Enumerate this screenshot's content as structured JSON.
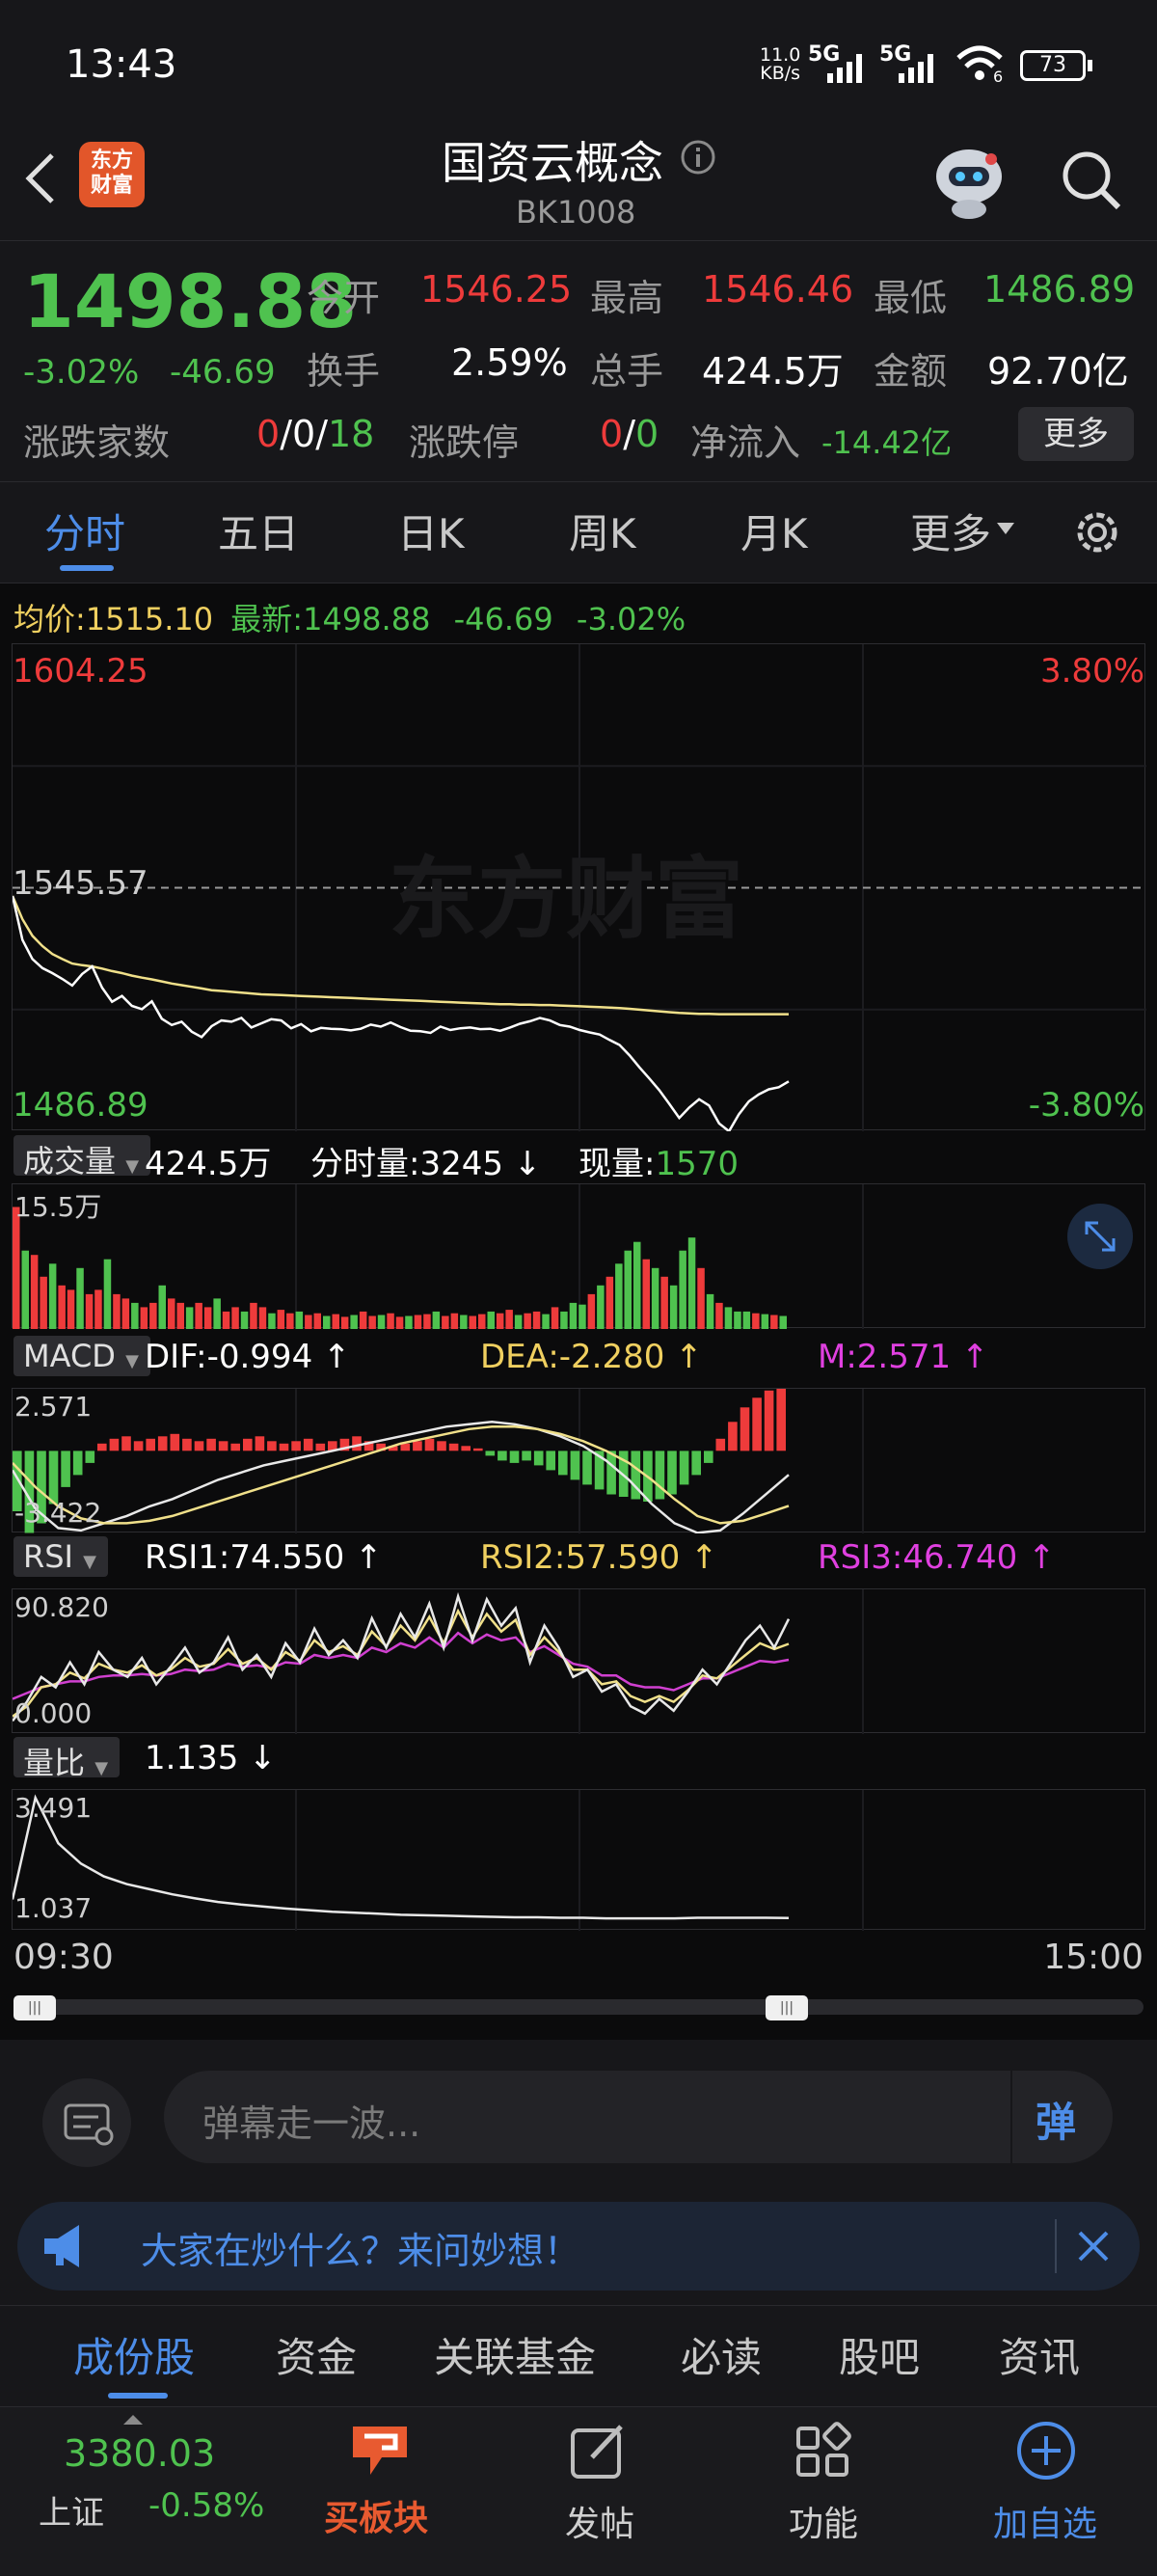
{
  "status_bar": {
    "time": "13:43",
    "net_speed": "11.0",
    "net_unit": "KB/s",
    "sig1": "5G",
    "sig2": "5G",
    "battery": "73",
    "wifi_num": "6"
  },
  "header": {
    "logo_line1": "东方",
    "logo_line2": "财富",
    "title": "国资云概念",
    "code": "BK1008"
  },
  "quote": {
    "price": "1498.88",
    "change_pct": "-3.02%",
    "change": "-46.69",
    "open_label": "今开",
    "open": "1546.25",
    "high_label": "最高",
    "high": "1546.46",
    "low_label": "最低",
    "low": "1486.89",
    "turnover_label": "换手",
    "turnover": "2.59%",
    "volume_label": "总手",
    "volume": "424.5万",
    "amount_label": "金额",
    "amount": "92.70亿",
    "updown_label": "涨跌家数",
    "up": "0",
    "flat": "0",
    "down": "18",
    "sep": "/",
    "limit_label": "涨跌停",
    "limit_up": "0",
    "limit_down": "0",
    "netflow_label": "净流入",
    "netflow": "-14.42亿",
    "more_button": "更多"
  },
  "tabs": {
    "items": [
      "分时",
      "五日",
      "日K",
      "周K",
      "月K",
      "更多"
    ],
    "active": "分时"
  },
  "chart_data": [
    {
      "type": "line",
      "title": "",
      "info": {
        "avg_label": "均价:",
        "avg": "1515.10",
        "latest_label": "最新:",
        "latest": "1498.88",
        "change": "-46.69",
        "pct": "-3.02%"
      },
      "y_max_label": "1604.25",
      "y_mid_label": "1545.57",
      "y_min_label": "1486.89",
      "pct_max_label": "3.80%",
      "pct_min_label": "-3.80%",
      "watermark": "东方财富",
      "x_labels": [
        "09:30",
        "15:00"
      ],
      "ylim": [
        1486.89,
        1604.25
      ],
      "series": [
        {
          "name": "最新",
          "color": "#ffffff",
          "values": [
            1543.6,
            1533.0,
            1528.4,
            1526.2,
            1525.0,
            1523.6,
            1522.0,
            1524.8,
            1526.6,
            1521.5,
            1518.1,
            1519.5,
            1517.1,
            1516.3,
            1518.2,
            1514.0,
            1512.5,
            1513.3,
            1510.9,
            1509.6,
            1512.2,
            1513.6,
            1513.3,
            1514.2,
            1511.9,
            1512.9,
            1513.9,
            1513.6,
            1511.7,
            1512.7,
            1511.0,
            1511.8,
            1511.6,
            1511.5,
            1511.2,
            1511.6,
            1512.6,
            1512.1,
            1513.1,
            1512.0,
            1511.1,
            1511.0,
            1510.6,
            1512.1,
            1511.3,
            1511.7,
            1511.9,
            1511.5,
            1511.6,
            1511.1,
            1511.9,
            1512.8,
            1513.4,
            1514.2,
            1513.6,
            1512.5,
            1512.1,
            1511.3,
            1510.7,
            1510.2,
            1508.9,
            1507.7,
            1505.2,
            1502.3,
            1499.6,
            1496.8,
            1493.5,
            1490.1,
            1492.6,
            1494.6,
            1493.1,
            1488.8,
            1486.9,
            1491.0,
            1494.1,
            1495.8,
            1497.0,
            1497.5,
            1498.9
          ]
        },
        {
          "name": "均价",
          "color": "#f0e08a",
          "values": [
            1543.6,
            1538.0,
            1534.0,
            1531.5,
            1529.6,
            1528.4,
            1527.3,
            1526.9,
            1526.6,
            1526.1,
            1525.5,
            1525.0,
            1524.4,
            1523.9,
            1523.5,
            1523.0,
            1522.5,
            1522.1,
            1521.7,
            1521.3,
            1520.9,
            1520.7,
            1520.5,
            1520.3,
            1520.1,
            1519.9,
            1519.8,
            1519.7,
            1519.6,
            1519.5,
            1519.4,
            1519.3,
            1519.2,
            1519.1,
            1519.0,
            1518.9,
            1518.8,
            1518.7,
            1518.6,
            1518.5,
            1518.4,
            1518.3,
            1518.2,
            1518.1,
            1518.0,
            1517.9,
            1517.8,
            1517.7,
            1517.6,
            1517.5,
            1517.5,
            1517.4,
            1517.4,
            1517.3,
            1517.3,
            1517.2,
            1517.1,
            1517.0,
            1516.9,
            1516.8,
            1516.7,
            1516.6,
            1516.4,
            1516.2,
            1516.0,
            1515.8,
            1515.6,
            1515.4,
            1515.3,
            1515.2,
            1515.2,
            1515.1,
            1515.1,
            1515.1,
            1515.1,
            1515.1,
            1515.1,
            1515.1,
            1515.1
          ]
        }
      ]
    },
    {
      "type": "bar",
      "label": "成交量",
      "total": "424.5万",
      "period_label": "分时量:",
      "period_value": "3245",
      "period_arrow": "↓",
      "now_label": "现量:",
      "now_value": "1570",
      "y_max_label": "15.5万",
      "values": [
        14.0,
        9.0,
        8.5,
        6.0,
        7.5,
        5.0,
        4.5,
        7.0,
        4.0,
        4.5,
        8.0,
        4.0,
        3.5,
        3.0,
        2.5,
        3.0,
        5.0,
        3.5,
        3.0,
        2.5,
        3.0,
        2.5,
        3.5,
        2.0,
        2.5,
        2.0,
        3.0,
        2.5,
        1.8,
        2.2,
        1.8,
        2.0,
        1.6,
        1.8,
        1.5,
        1.7,
        1.4,
        1.6,
        2.0,
        1.5,
        1.6,
        1.8,
        1.4,
        1.5,
        1.6,
        1.7,
        2.0,
        1.5,
        1.8,
        1.6,
        1.5,
        1.7,
        2.0,
        1.8,
        2.2,
        1.6,
        1.8,
        2.0,
        1.7,
        2.5,
        2.0,
        3.0,
        2.8,
        4.0,
        5.0,
        6.0,
        7.5,
        9.0,
        10.0,
        8.0,
        7.0,
        6.0,
        5.0,
        9.0,
        10.5,
        7.0,
        4.0,
        3.0,
        2.5,
        2.0,
        2.0,
        1.8,
        1.7,
        1.6,
        1.5
      ],
      "colors": "rg"
    },
    {
      "type": "bar",
      "label": "MACD",
      "dif_label": "DIF:",
      "dif": "-0.994",
      "dif_arrow": "↑",
      "dea_label": "DEA:",
      "dea": "-2.280",
      "dea_arrow": "↑",
      "m_label": "M:",
      "m": "2.571",
      "m_arrow": "↑",
      "y_max_label": "2.571",
      "y_min_label": "-3.422",
      "hist": [
        -2.5,
        -3.4,
        -3.0,
        -2.2,
        -1.5,
        -1.0,
        -0.5,
        0.3,
        0.5,
        0.6,
        0.4,
        0.5,
        0.6,
        0.7,
        0.5,
        0.4,
        0.5,
        0.4,
        0.3,
        0.5,
        0.6,
        0.4,
        0.3,
        0.4,
        0.5,
        0.3,
        0.4,
        0.5,
        0.6,
        0.4,
        0.3,
        0.2,
        0.3,
        0.4,
        0.5,
        0.4,
        0.3,
        0.2,
        0.1,
        -0.2,
        -0.4,
        -0.5,
        -0.4,
        -0.6,
        -0.8,
        -1.0,
        -1.2,
        -1.4,
        -1.6,
        -1.8,
        -1.9,
        -2.0,
        -2.1,
        -2.0,
        -1.8,
        -1.4,
        -1.0,
        -0.5,
        0.5,
        1.2,
        1.8,
        2.2,
        2.5,
        2.57
      ],
      "dif_line": [
        -0.8,
        -2.4,
        -3.2,
        -3.3,
        -3.0,
        -2.7,
        -2.3,
        -2.0,
        -1.6,
        -1.2,
        -0.9,
        -0.6,
        -0.4,
        -0.2,
        0.0,
        0.2,
        0.4,
        0.6,
        0.8,
        1.0,
        1.1,
        1.2,
        1.1,
        0.9,
        0.6,
        0.2,
        -0.4,
        -1.2,
        -2.2,
        -3.0,
        -3.4,
        -3.3,
        -2.6,
        -1.8,
        -0.994
      ],
      "dea_line": [
        -0.5,
        -1.5,
        -2.3,
        -2.8,
        -3.0,
        -3.0,
        -2.9,
        -2.7,
        -2.4,
        -2.1,
        -1.8,
        -1.5,
        -1.2,
        -0.9,
        -0.6,
        -0.3,
        0.0,
        0.3,
        0.5,
        0.7,
        0.9,
        1.0,
        1.0,
        0.9,
        0.7,
        0.4,
        0.0,
        -0.5,
        -1.2,
        -2.0,
        -2.7,
        -3.0,
        -2.9,
        -2.6,
        -2.28
      ]
    },
    {
      "type": "line",
      "label": "RSI",
      "rsi1_label": "RSI1:",
      "rsi1": "74.550",
      "rsi1_arrow": "↑",
      "rsi2_label": "RSI2:",
      "rsi2": "57.590",
      "rsi2_arrow": "↑",
      "rsi3_label": "RSI3:",
      "rsi3": "46.740",
      "rsi3_arrow": "↑",
      "y_max_label": "90.820",
      "y_min_label": "0.000",
      "ylim": [
        0,
        90.82
      ],
      "series": [
        {
          "name": "RSI1",
          "color": "#e8e8e8",
          "values": [
            5,
            18,
            35,
            28,
            45,
            30,
            52,
            40,
            35,
            48,
            30,
            42,
            55,
            38,
            45,
            62,
            40,
            50,
            35,
            58,
            45,
            68,
            50,
            60,
            48,
            75,
            55,
            78,
            62,
            85,
            55,
            90,
            60,
            88,
            70,
            82,
            45,
            70,
            55,
            35,
            40,
            25,
            30,
            15,
            10,
            20,
            12,
            25,
            40,
            30,
            45,
            60,
            70,
            55,
            74.55
          ]
        },
        {
          "name": "RSI2",
          "color": "#f0e08a",
          "values": [
            8,
            15,
            28,
            30,
            38,
            34,
            44,
            40,
            38,
            43,
            36,
            40,
            48,
            42,
            44,
            54,
            44,
            48,
            40,
            52,
            46,
            60,
            52,
            56,
            50,
            66,
            56,
            70,
            60,
            76,
            58,
            80,
            62,
            78,
            66,
            74,
            50,
            62,
            52,
            40,
            40,
            30,
            32,
            22,
            18,
            22,
            18,
            26,
            36,
            34,
            42,
            50,
            58,
            54,
            57.59
          ]
        },
        {
          "name": "RSI3",
          "color": "#d040d0",
          "values": [
            20,
            24,
            28,
            30,
            32,
            32,
            35,
            36,
            36,
            37,
            36,
            37,
            40,
            39,
            40,
            44,
            42,
            43,
            41,
            45,
            44,
            50,
            48,
            50,
            48,
            55,
            52,
            58,
            55,
            62,
            55,
            65,
            58,
            64,
            60,
            62,
            52,
            56,
            50,
            44,
            42,
            36,
            36,
            30,
            28,
            28,
            26,
            30,
            34,
            34,
            38,
            42,
            46,
            45,
            46.74
          ]
        }
      ]
    },
    {
      "type": "line",
      "label": "量比",
      "value": "1.135",
      "arrow": "↓",
      "y_max_label": "3.491",
      "y_min_label": "1.037",
      "ylim": [
        1.037,
        3.491
      ],
      "series": [
        {
          "name": "量比",
          "color": "#e8e8e8",
          "values": [
            1.5,
            3.49,
            2.6,
            2.2,
            1.95,
            1.8,
            1.7,
            1.6,
            1.52,
            1.45,
            1.4,
            1.36,
            1.32,
            1.29,
            1.26,
            1.24,
            1.22,
            1.2,
            1.19,
            1.18,
            1.17,
            1.16,
            1.15,
            1.15,
            1.14,
            1.14,
            1.13,
            1.13,
            1.13,
            1.13,
            1.14,
            1.14,
            1.14,
            1.14,
            1.135
          ]
        }
      ]
    }
  ],
  "danmu": {
    "placeholder": "弹幕走一波...",
    "send_label": "弹"
  },
  "ai_bar": {
    "text": "大家在炒什么？来问妙想！"
  },
  "bottom_tabs": {
    "items": [
      "成份股",
      "资金",
      "关联基金",
      "必读",
      "股吧",
      "资讯"
    ],
    "active": "成份股"
  },
  "footer": {
    "index_value": "3380.03",
    "index_name": "上证",
    "index_change": "-0.58%",
    "buy_label": "买板块",
    "post_label": "发帖",
    "func_label": "功能",
    "add_label": "加自选"
  }
}
